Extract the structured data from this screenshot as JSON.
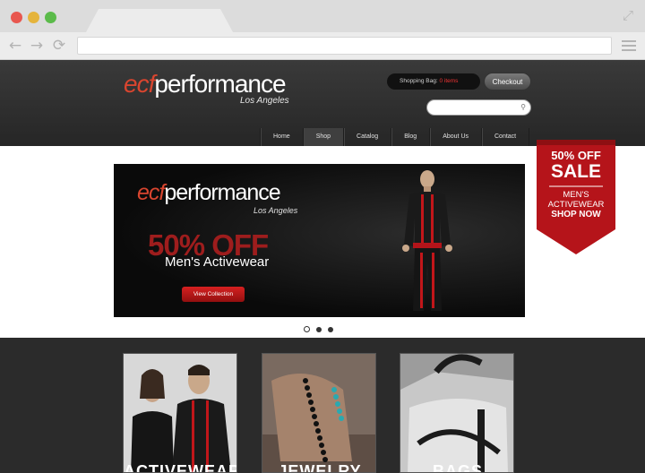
{
  "brand": {
    "prefix": "ecf",
    "name": "performance",
    "location": "Los Angeles"
  },
  "header": {
    "bag_label": "Shopping Bag:",
    "bag_count": "0 items",
    "checkout_label": "Checkout",
    "search_placeholder": ""
  },
  "nav": {
    "items": [
      {
        "label": "Home"
      },
      {
        "label": "Shop"
      },
      {
        "label": "Catalog"
      },
      {
        "label": "Blog"
      },
      {
        "label": "About Us"
      },
      {
        "label": "Contact"
      }
    ],
    "active": "Shop"
  },
  "slider": {
    "headline": "50% OFF",
    "subhead": "Men's Activewear",
    "cta": "View Collection",
    "slides": 3,
    "active_slide": 1
  },
  "ribbon": {
    "line1": "50% OFF",
    "line2": "SALE",
    "line3": "MEN'S",
    "line4": "ACTIVEWEAR",
    "line5": "SHOP NOW"
  },
  "categories": [
    {
      "label": "ACTIVEWEAR"
    },
    {
      "label": "JEWELRY"
    },
    {
      "label": "BAGS"
    }
  ],
  "colors": {
    "accent": "#d8452f",
    "ribbon": "#b5141a",
    "header_bg": "#2e2e2e"
  }
}
